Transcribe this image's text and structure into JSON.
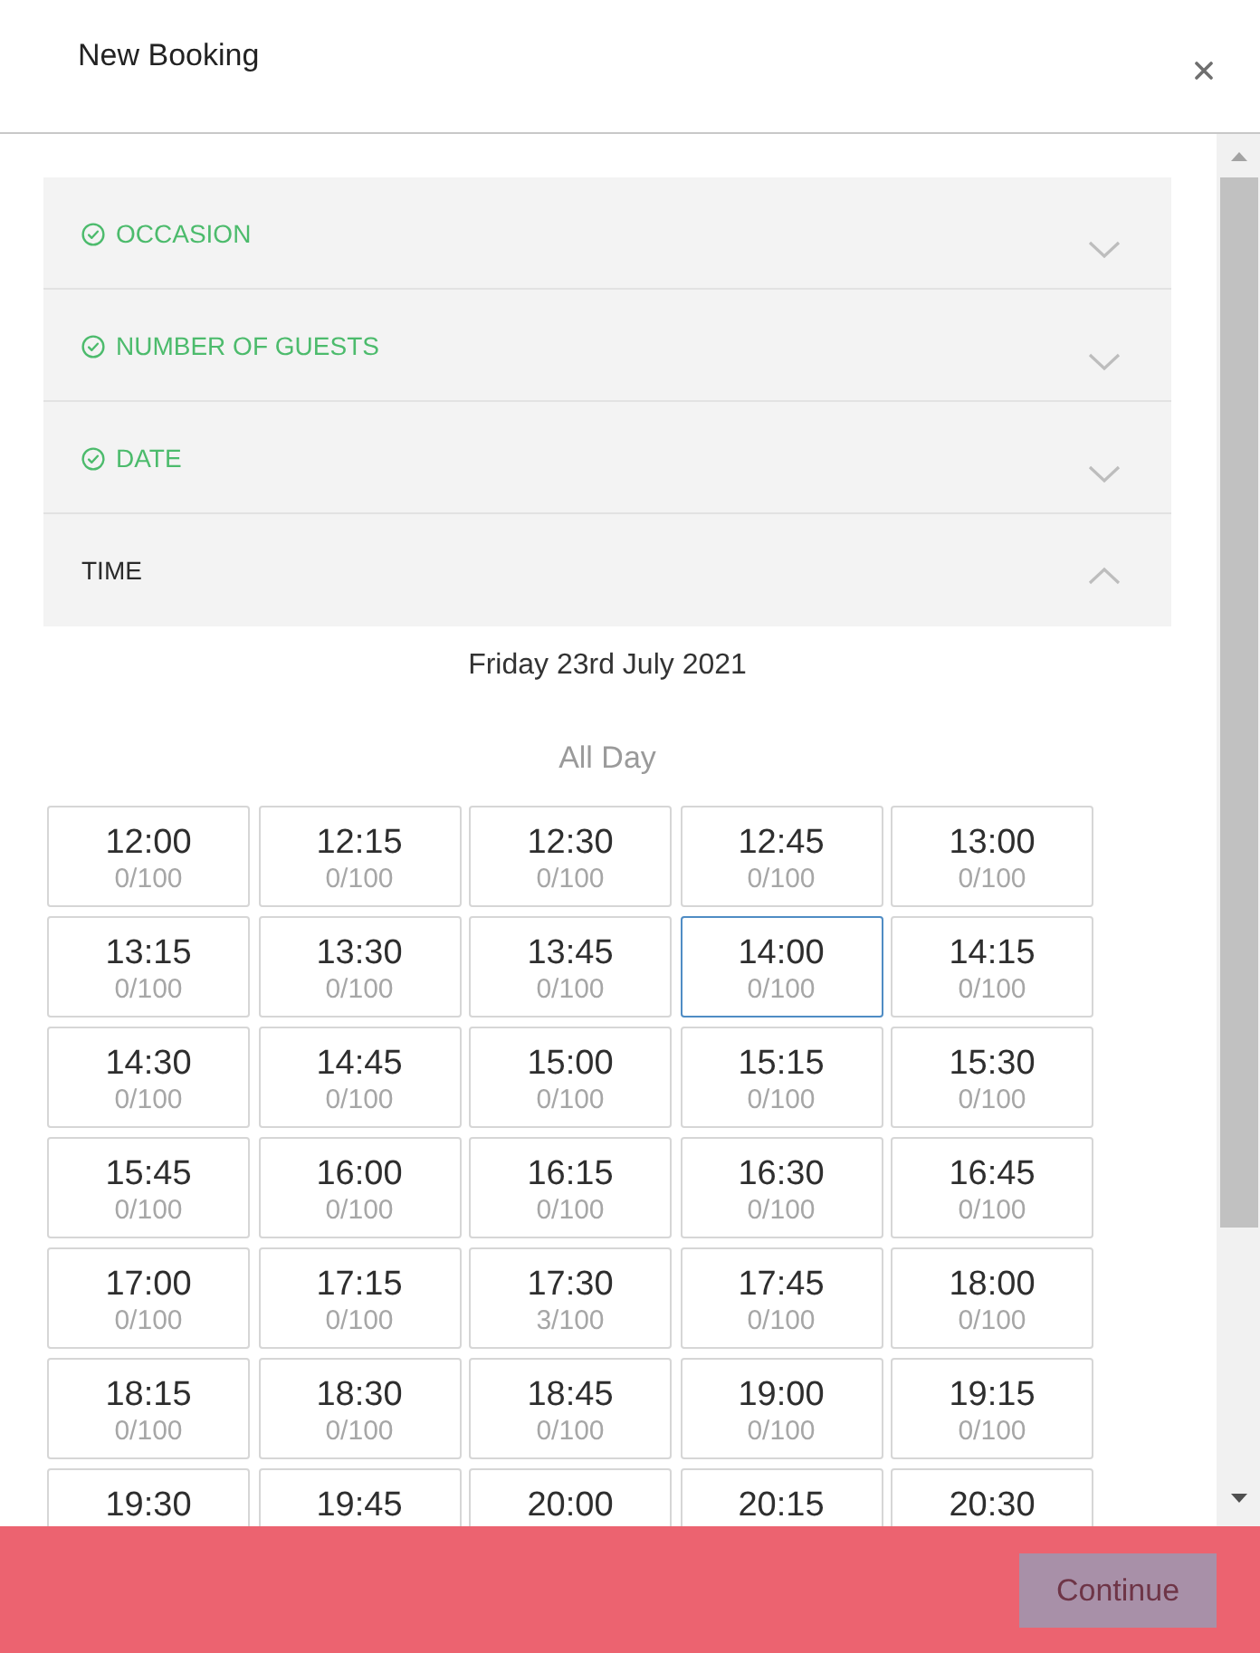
{
  "header": {
    "title": "New Booking"
  },
  "sections": [
    {
      "label": "OCCASION",
      "completed": true,
      "expanded": false
    },
    {
      "label": "NUMBER OF GUESTS",
      "completed": true,
      "expanded": false
    },
    {
      "label": "DATE",
      "completed": true,
      "expanded": false
    },
    {
      "label": "TIME",
      "completed": false,
      "expanded": true
    }
  ],
  "time_panel": {
    "date": "Friday 23rd July 2021",
    "period": "All Day",
    "slots": [
      {
        "time": "12:00",
        "capacity": "0/100",
        "selected": false
      },
      {
        "time": "12:15",
        "capacity": "0/100",
        "selected": false
      },
      {
        "time": "12:30",
        "capacity": "0/100",
        "selected": false
      },
      {
        "time": "12:45",
        "capacity": "0/100",
        "selected": false
      },
      {
        "time": "13:00",
        "capacity": "0/100",
        "selected": false
      },
      {
        "time": "13:15",
        "capacity": "0/100",
        "selected": false
      },
      {
        "time": "13:30",
        "capacity": "0/100",
        "selected": false
      },
      {
        "time": "13:45",
        "capacity": "0/100",
        "selected": false
      },
      {
        "time": "14:00",
        "capacity": "0/100",
        "selected": true
      },
      {
        "time": "14:15",
        "capacity": "0/100",
        "selected": false
      },
      {
        "time": "14:30",
        "capacity": "0/100",
        "selected": false
      },
      {
        "time": "14:45",
        "capacity": "0/100",
        "selected": false
      },
      {
        "time": "15:00",
        "capacity": "0/100",
        "selected": false
      },
      {
        "time": "15:15",
        "capacity": "0/100",
        "selected": false
      },
      {
        "time": "15:30",
        "capacity": "0/100",
        "selected": false
      },
      {
        "time": "15:45",
        "capacity": "0/100",
        "selected": false
      },
      {
        "time": "16:00",
        "capacity": "0/100",
        "selected": false
      },
      {
        "time": "16:15",
        "capacity": "0/100",
        "selected": false
      },
      {
        "time": "16:30",
        "capacity": "0/100",
        "selected": false
      },
      {
        "time": "16:45",
        "capacity": "0/100",
        "selected": false
      },
      {
        "time": "17:00",
        "capacity": "0/100",
        "selected": false
      },
      {
        "time": "17:15",
        "capacity": "0/100",
        "selected": false
      },
      {
        "time": "17:30",
        "capacity": "3/100",
        "selected": false
      },
      {
        "time": "17:45",
        "capacity": "0/100",
        "selected": false
      },
      {
        "time": "18:00",
        "capacity": "0/100",
        "selected": false
      },
      {
        "time": "18:15",
        "capacity": "0/100",
        "selected": false
      },
      {
        "time": "18:30",
        "capacity": "0/100",
        "selected": false
      },
      {
        "time": "18:45",
        "capacity": "0/100",
        "selected": false
      },
      {
        "time": "19:00",
        "capacity": "0/100",
        "selected": false
      },
      {
        "time": "19:15",
        "capacity": "0/100",
        "selected": false
      },
      {
        "time": "19:30",
        "selected": false
      },
      {
        "time": "19:45",
        "selected": false
      },
      {
        "time": "20:00",
        "selected": false
      },
      {
        "time": "20:15",
        "selected": false
      },
      {
        "time": "20:30",
        "selected": false
      }
    ]
  },
  "footer": {
    "continue_button": "Continue"
  }
}
